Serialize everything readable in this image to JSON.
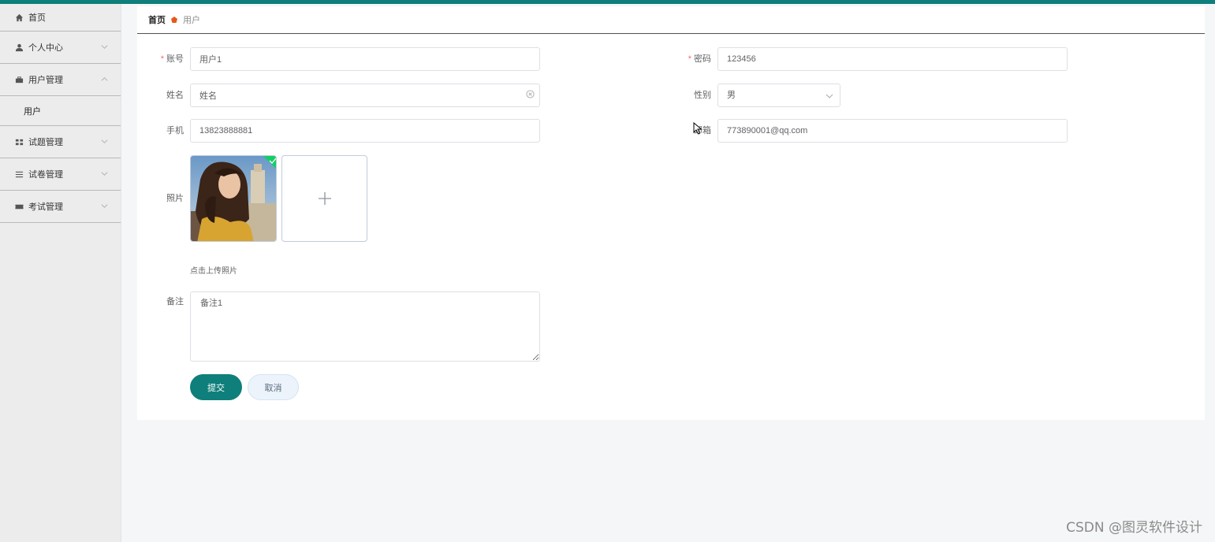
{
  "sidebar": {
    "items": [
      {
        "label": "首页",
        "icon": "home-icon"
      },
      {
        "label": "个人中心",
        "icon": "user-icon"
      },
      {
        "label": "用户管理",
        "icon": "briefcase-icon"
      },
      {
        "label": "用户"
      },
      {
        "label": "试题管理",
        "icon": "grid-icon"
      },
      {
        "label": "试卷管理",
        "icon": "list-icon"
      },
      {
        "label": "考试管理",
        "icon": "ticket-icon"
      }
    ]
  },
  "breadcrumb": {
    "home": "首页",
    "current": "用户"
  },
  "form": {
    "account": {
      "label": "账号",
      "value": "用户1",
      "required": true
    },
    "password": {
      "label": "密码",
      "value": "123456",
      "required": true
    },
    "name": {
      "label": "姓名",
      "value": "姓名"
    },
    "gender": {
      "label": "性别",
      "value": "男"
    },
    "phone": {
      "label": "手机",
      "value": "13823888881"
    },
    "email": {
      "label": "邮箱",
      "value": "773890001@qq.com"
    },
    "photo": {
      "label": "照片",
      "tip": "点击上传照片"
    },
    "remark": {
      "label": "备注",
      "value": "备注1"
    },
    "submit_label": "提交",
    "cancel_label": "取消"
  },
  "watermark": "CSDN @图灵软件设计",
  "colors": {
    "accent": "#0e7f7a",
    "required": "#f56c6c",
    "success": "#13ce66",
    "breadcrumb_separator": "#e8561c"
  }
}
